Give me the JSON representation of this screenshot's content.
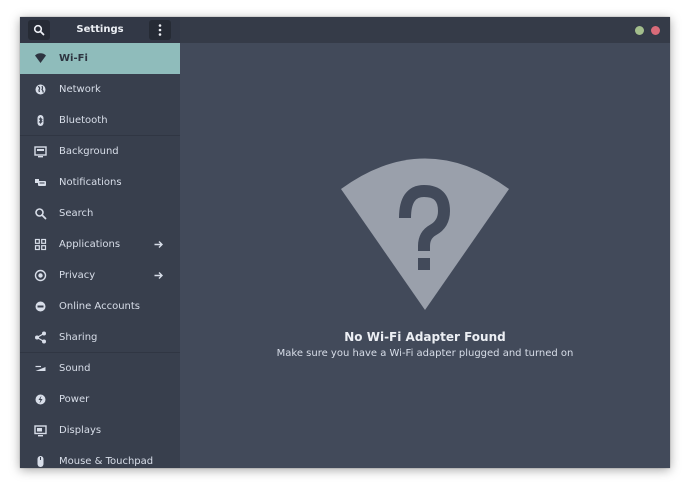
{
  "header": {
    "title": "Settings",
    "search_icon": "search-icon",
    "menu_icon": "vertical-dots-icon"
  },
  "window_controls": {
    "maximize_color": "#a3be8c",
    "close_color": "#d96b79"
  },
  "colors": {
    "accent": "#8fbcbb",
    "sidebar_bg": "#383f4d",
    "content_bg": "#424a5a"
  },
  "sidebar": {
    "items": [
      {
        "label": "Wi-Fi",
        "icon": "wifi-icon",
        "active": true
      },
      {
        "label": "Network",
        "icon": "globe-icon"
      },
      {
        "label": "Bluetooth",
        "icon": "bluetooth-icon"
      },
      {
        "label": "Background",
        "icon": "monitor-icon"
      },
      {
        "label": "Notifications",
        "icon": "notifications-icon"
      },
      {
        "label": "Search",
        "icon": "search-icon"
      },
      {
        "label": "Applications",
        "icon": "grid-icon",
        "has_arrow": true
      },
      {
        "label": "Privacy",
        "icon": "privacy-icon",
        "has_arrow": true
      },
      {
        "label": "Online Accounts",
        "icon": "accounts-icon"
      },
      {
        "label": "Sharing",
        "icon": "share-icon"
      },
      {
        "label": "Sound",
        "icon": "sound-icon"
      },
      {
        "label": "Power",
        "icon": "power-icon"
      },
      {
        "label": "Displays",
        "icon": "display-icon"
      },
      {
        "label": "Mouse & Touchpad",
        "icon": "mouse-icon"
      }
    ]
  },
  "main": {
    "empty_state": {
      "icon": "wifi-unknown-icon",
      "title": "No Wi-Fi Adapter Found",
      "subtitle": "Make sure you have a Wi-Fi adapter plugged and turned on"
    }
  }
}
